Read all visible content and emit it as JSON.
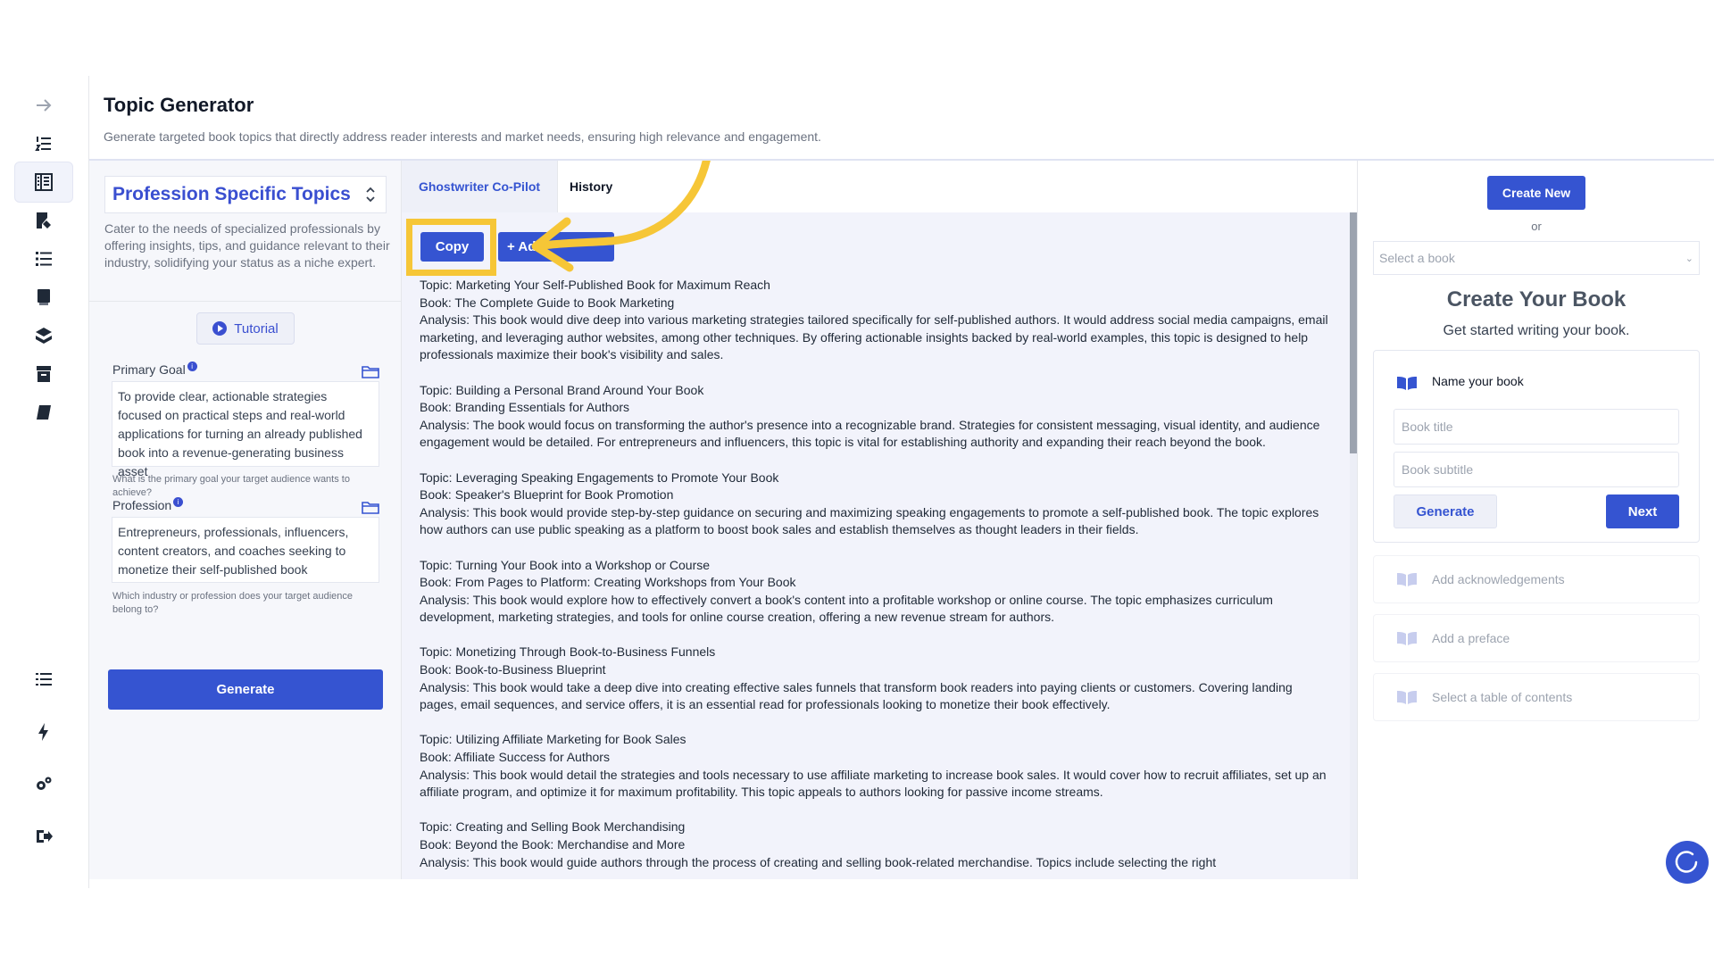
{
  "header": {
    "title": "Topic Generator",
    "subtitle": "Generate targeted book topics that directly address reader interests and market needs, ensuring high relevance and engagement."
  },
  "form": {
    "topic_type": "Profession Specific Topics",
    "topic_description": "Cater to the needs of specialized professionals by offering insights, tips, and guidance relevant to their industry, solidifying your status as a niche expert.",
    "tutorial_label": "Tutorial",
    "primary_goal": {
      "label": "Primary Goal",
      "value": "To provide clear, actionable strategies focused on practical steps and real-world applications for turning an already published book into a revenue-generating business asset",
      "help": "What is the primary goal your target audience wants to achieve?"
    },
    "profession": {
      "label": "Profession",
      "value": "Entrepreneurs, professionals, influencers, content creators, and coaches seeking to monetize their self-published book",
      "help": "Which industry or profession does your target audience belong to?"
    },
    "generate_label": "Generate"
  },
  "results": {
    "tabs": [
      "Ghostwriter Co-Pilot",
      "History"
    ],
    "copy_label": "Copy",
    "add_label": "+ Add",
    "entries": [
      {
        "topic": "Topic: Marketing Your Self-Published Book for Maximum Reach",
        "book": "Book: The Complete Guide to Book Marketing",
        "analysis": "Analysis: This book would dive deep into various marketing strategies tailored specifically for self-published authors. It would address social media campaigns, email marketing, and leveraging author websites, among other techniques. By offering actionable insights backed by real-world examples, this topic is designed to help professionals maximize their book's visibility and sales."
      },
      {
        "topic": "Topic: Building a Personal Brand Around Your Book",
        "book": "Book: Branding Essentials for Authors",
        "analysis": "Analysis: The book would focus on transforming the author's presence into a recognizable brand. Strategies for consistent messaging, visual identity, and audience engagement would be detailed. For entrepreneurs and influencers, this topic is vital for establishing authority and expanding their reach beyond the book."
      },
      {
        "topic": "Topic: Leveraging Speaking Engagements to Promote Your Book",
        "book": "Book: Speaker's Blueprint for Book Promotion",
        "analysis": "Analysis: This book would provide step-by-step guidance on securing and maximizing speaking engagements to promote a self-published book. The topic explores how authors can use public speaking as a platform to boost book sales and establish themselves as thought leaders in their fields."
      },
      {
        "topic": "Topic: Turning Your Book into a Workshop or Course",
        "book": "Book: From Pages to Platform: Creating Workshops from Your Book",
        "analysis": "Analysis: This book would explore how to effectively convert a book's content into a profitable workshop or online course. The topic emphasizes curriculum development, marketing strategies, and tools for online course creation, offering a new revenue stream for authors."
      },
      {
        "topic": "Topic: Monetizing Through Book-to-Business Funnels",
        "book": "Book: Book-to-Business Blueprint",
        "analysis": "Analysis: This book would take a deep dive into creating effective sales funnels that transform book readers into paying clients or customers. Covering landing pages, email sequences, and service offers, it is an essential read for professionals looking to monetize their book effectively."
      },
      {
        "topic": "Topic: Utilizing Affiliate Marketing for Book Sales",
        "book": "Book: Affiliate Success for Authors",
        "analysis": "Analysis: This book would detail the strategies and tools necessary to use affiliate marketing to increase book sales. It would cover how to recruit affiliates, set up an affiliate program, and optimize it for maximum profitability. This topic appeals to authors looking for passive income streams."
      },
      {
        "topic": "Topic: Creating and Selling Book Merchandising",
        "book": "Book: Beyond the Book: Merchandise and More",
        "analysis": "Analysis: This book would guide authors through the process of creating and selling book-related merchandise. Topics include selecting the right"
      }
    ]
  },
  "right_panel": {
    "create_new_label": "Create New",
    "or_text": "or",
    "select_book_placeholder": "Select a book",
    "title": "Create Your Book",
    "subtitle": "Get started writing your book.",
    "name_label": "Name your book",
    "book_title_placeholder": "Book title",
    "book_subtitle_placeholder": "Book subtitle",
    "generate_label": "Generate",
    "next_label": "Next",
    "steps": [
      "Add acknowledgements",
      "Add a preface",
      "Select a table of contents"
    ]
  },
  "colors": {
    "accent": "#3554d1",
    "highlight": "#f6c637"
  }
}
